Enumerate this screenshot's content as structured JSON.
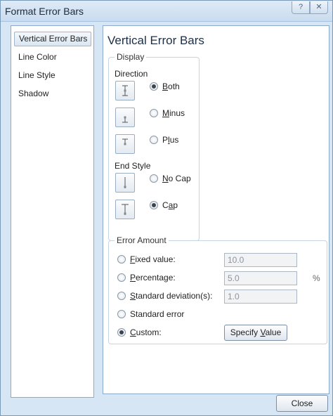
{
  "dialog": {
    "title": "Format Error Bars",
    "help_glyph": "?",
    "close_glyph": "✕"
  },
  "nav": {
    "items": [
      {
        "label": "Vertical Error Bars",
        "selected": true
      },
      {
        "label": "Line Color"
      },
      {
        "label": "Line Style"
      },
      {
        "label": "Shadow"
      }
    ]
  },
  "panel": {
    "heading": "Vertical Error Bars",
    "display": {
      "legend": "Display",
      "direction_label": "Direction",
      "direction_options": [
        {
          "label_pre": "",
          "label_u": "B",
          "label_post": "oth",
          "checked": true,
          "icon": "error-bar-both-icon"
        },
        {
          "label_pre": "",
          "label_u": "M",
          "label_post": "inus",
          "checked": false,
          "icon": "error-bar-minus-icon"
        },
        {
          "label_pre": "P",
          "label_u": "l",
          "label_post": "us",
          "checked": false,
          "icon": "error-bar-plus-icon"
        }
      ],
      "end_style_label": "End Style",
      "end_style_options": [
        {
          "label_pre": "",
          "label_u": "N",
          "label_post": "o Cap",
          "checked": false,
          "icon": "no-cap-icon"
        },
        {
          "label_pre": "C",
          "label_u": "a",
          "label_post": "p",
          "checked": true,
          "icon": "cap-icon"
        }
      ]
    },
    "error_amount": {
      "legend": "Error Amount",
      "fixed_label_u": "F",
      "fixed_label_rest": "ixed value:",
      "fixed_value": "10.0",
      "percentage_label_u": "P",
      "percentage_label_rest": "ercentage:",
      "percentage_value": "5.0",
      "percentage_unit": "%",
      "stddev_label_u": "S",
      "stddev_label_rest": "tandard deviation(s):",
      "stddev_value": "1.0",
      "stderr_label": "Standard error",
      "custom_label_u": "C",
      "custom_label_rest": "ustom:",
      "selected": "custom",
      "specify_pre": "Specify ",
      "specify_u": "V",
      "specify_post": "alue"
    }
  },
  "footer": {
    "close_label": "Close"
  }
}
